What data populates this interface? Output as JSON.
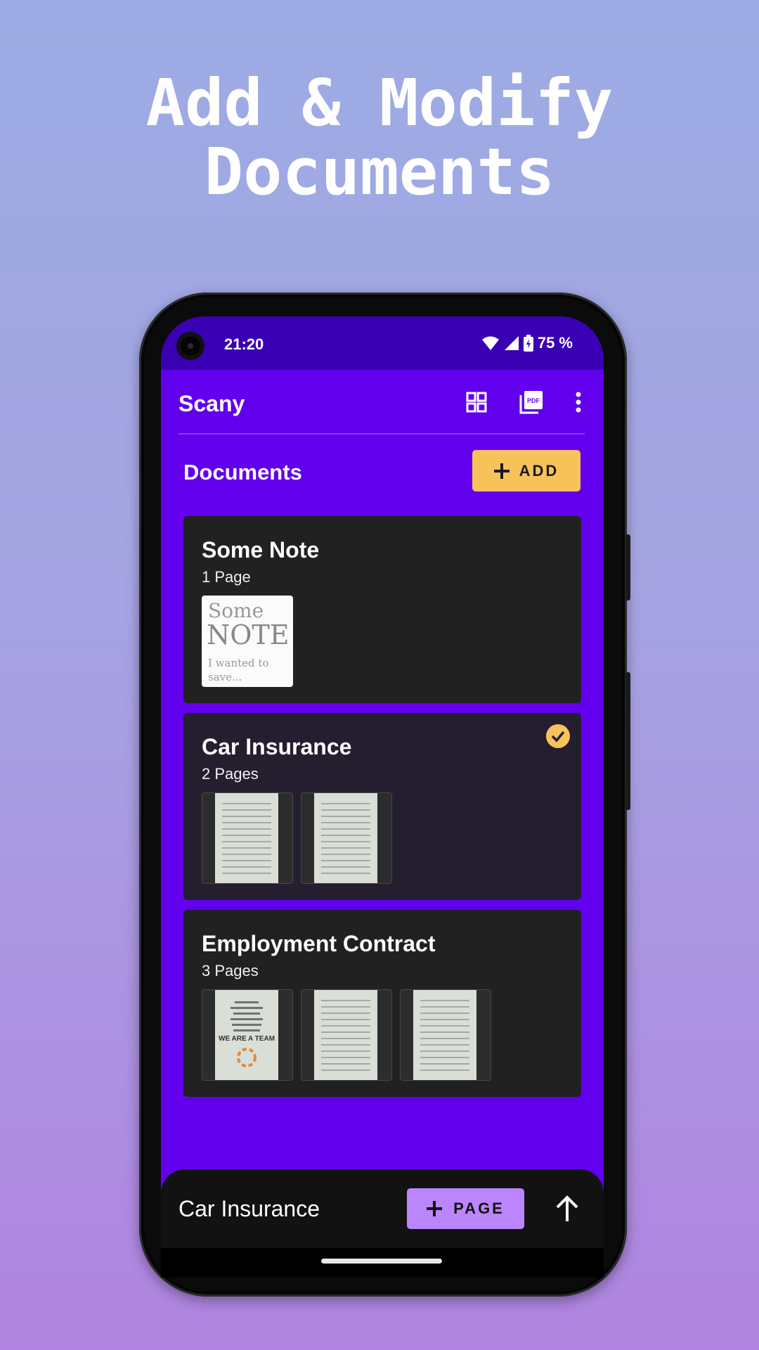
{
  "headline": {
    "line1": "Add & Modify",
    "line2": "Documents"
  },
  "status_bar": {
    "time": "21:20",
    "battery": "75 %"
  },
  "app_bar": {
    "title": "Scany",
    "icons": [
      "grid-icon",
      "pdf-icon",
      "more-vert-icon"
    ]
  },
  "section": {
    "title": "Documents",
    "add_label": "ADD"
  },
  "documents": [
    {
      "title": "Some Note",
      "pages": "1 Page",
      "selected": false,
      "thumb_text": [
        "Some",
        "NOTE",
        "I wanted to",
        "save..."
      ]
    },
    {
      "title": "Car Insurance",
      "pages": "2 Pages",
      "selected": true
    },
    {
      "title": "Employment Contract",
      "pages": "3 Pages",
      "selected": false,
      "thumb_text": [
        "WE ARE A TEAM"
      ]
    }
  ],
  "bottom_bar": {
    "title": "Car Insurance",
    "page_label": "PAGE"
  },
  "colors": {
    "primary": "#6200ee",
    "status_bar": "#3a00b3",
    "accent_yellow": "#f8c25b",
    "accent_purple": "#bb86fc",
    "card": "#212121"
  }
}
